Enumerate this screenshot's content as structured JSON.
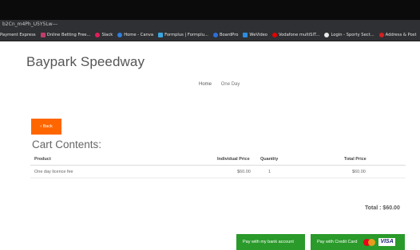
{
  "browser": {
    "url_text": "b2Cn_m4Ph_U5Y5Lw---",
    "bookmarks": [
      {
        "label": "Payment Express",
        "icon": "payment-express-icon",
        "color": ""
      },
      {
        "label": "Online Betting Free...",
        "icon": "betting-icon",
        "color": "#c23c6a"
      },
      {
        "label": "Slack",
        "icon": "slack-icon",
        "color": "#e01e5a"
      },
      {
        "label": "Home - Canva",
        "icon": "canva-icon",
        "color": "#2f7fdd"
      },
      {
        "label": "Formplus | Formplu...",
        "icon": "formplus-icon",
        "color": "#3aa6e0"
      },
      {
        "label": "BoardPro",
        "icon": "boardpro-icon",
        "color": "#2e6fd8"
      },
      {
        "label": "WeVideo",
        "icon": "wevideo-icon",
        "color": "#2b8de0"
      },
      {
        "label": "Vodafone multiSIT...",
        "icon": "vodafone-icon",
        "color": "#e60000"
      },
      {
        "label": "Login - Sporty Sect...",
        "icon": "sporty-icon",
        "color": "#eaeaea"
      },
      {
        "label": "Address & Post",
        "icon": "address-icon",
        "color": "#d32020"
      }
    ]
  },
  "site": {
    "title": "Baypark Speedway"
  },
  "breadcrumb": {
    "items": [
      "Home",
      "One Day"
    ]
  },
  "back_button": {
    "label": "‹ Back",
    "color": "#ff6600"
  },
  "cart": {
    "heading": "Cart Contents:",
    "columns": {
      "product": "Product",
      "individual_price": "Individual Price",
      "quantity": "Quantity",
      "total_price": "Total Price"
    },
    "rows": [
      {
        "product": "One day licence fee",
        "individual_price": "$60.00",
        "quantity": "1",
        "total_price": "$60.00"
      }
    ],
    "total_label": "Total : $60.00"
  },
  "payment": {
    "bank_label": "Pay with my bank account",
    "card_label": "Pay with Credit Card",
    "visa_text": "VISA",
    "button_color": "#2a9a2a"
  }
}
